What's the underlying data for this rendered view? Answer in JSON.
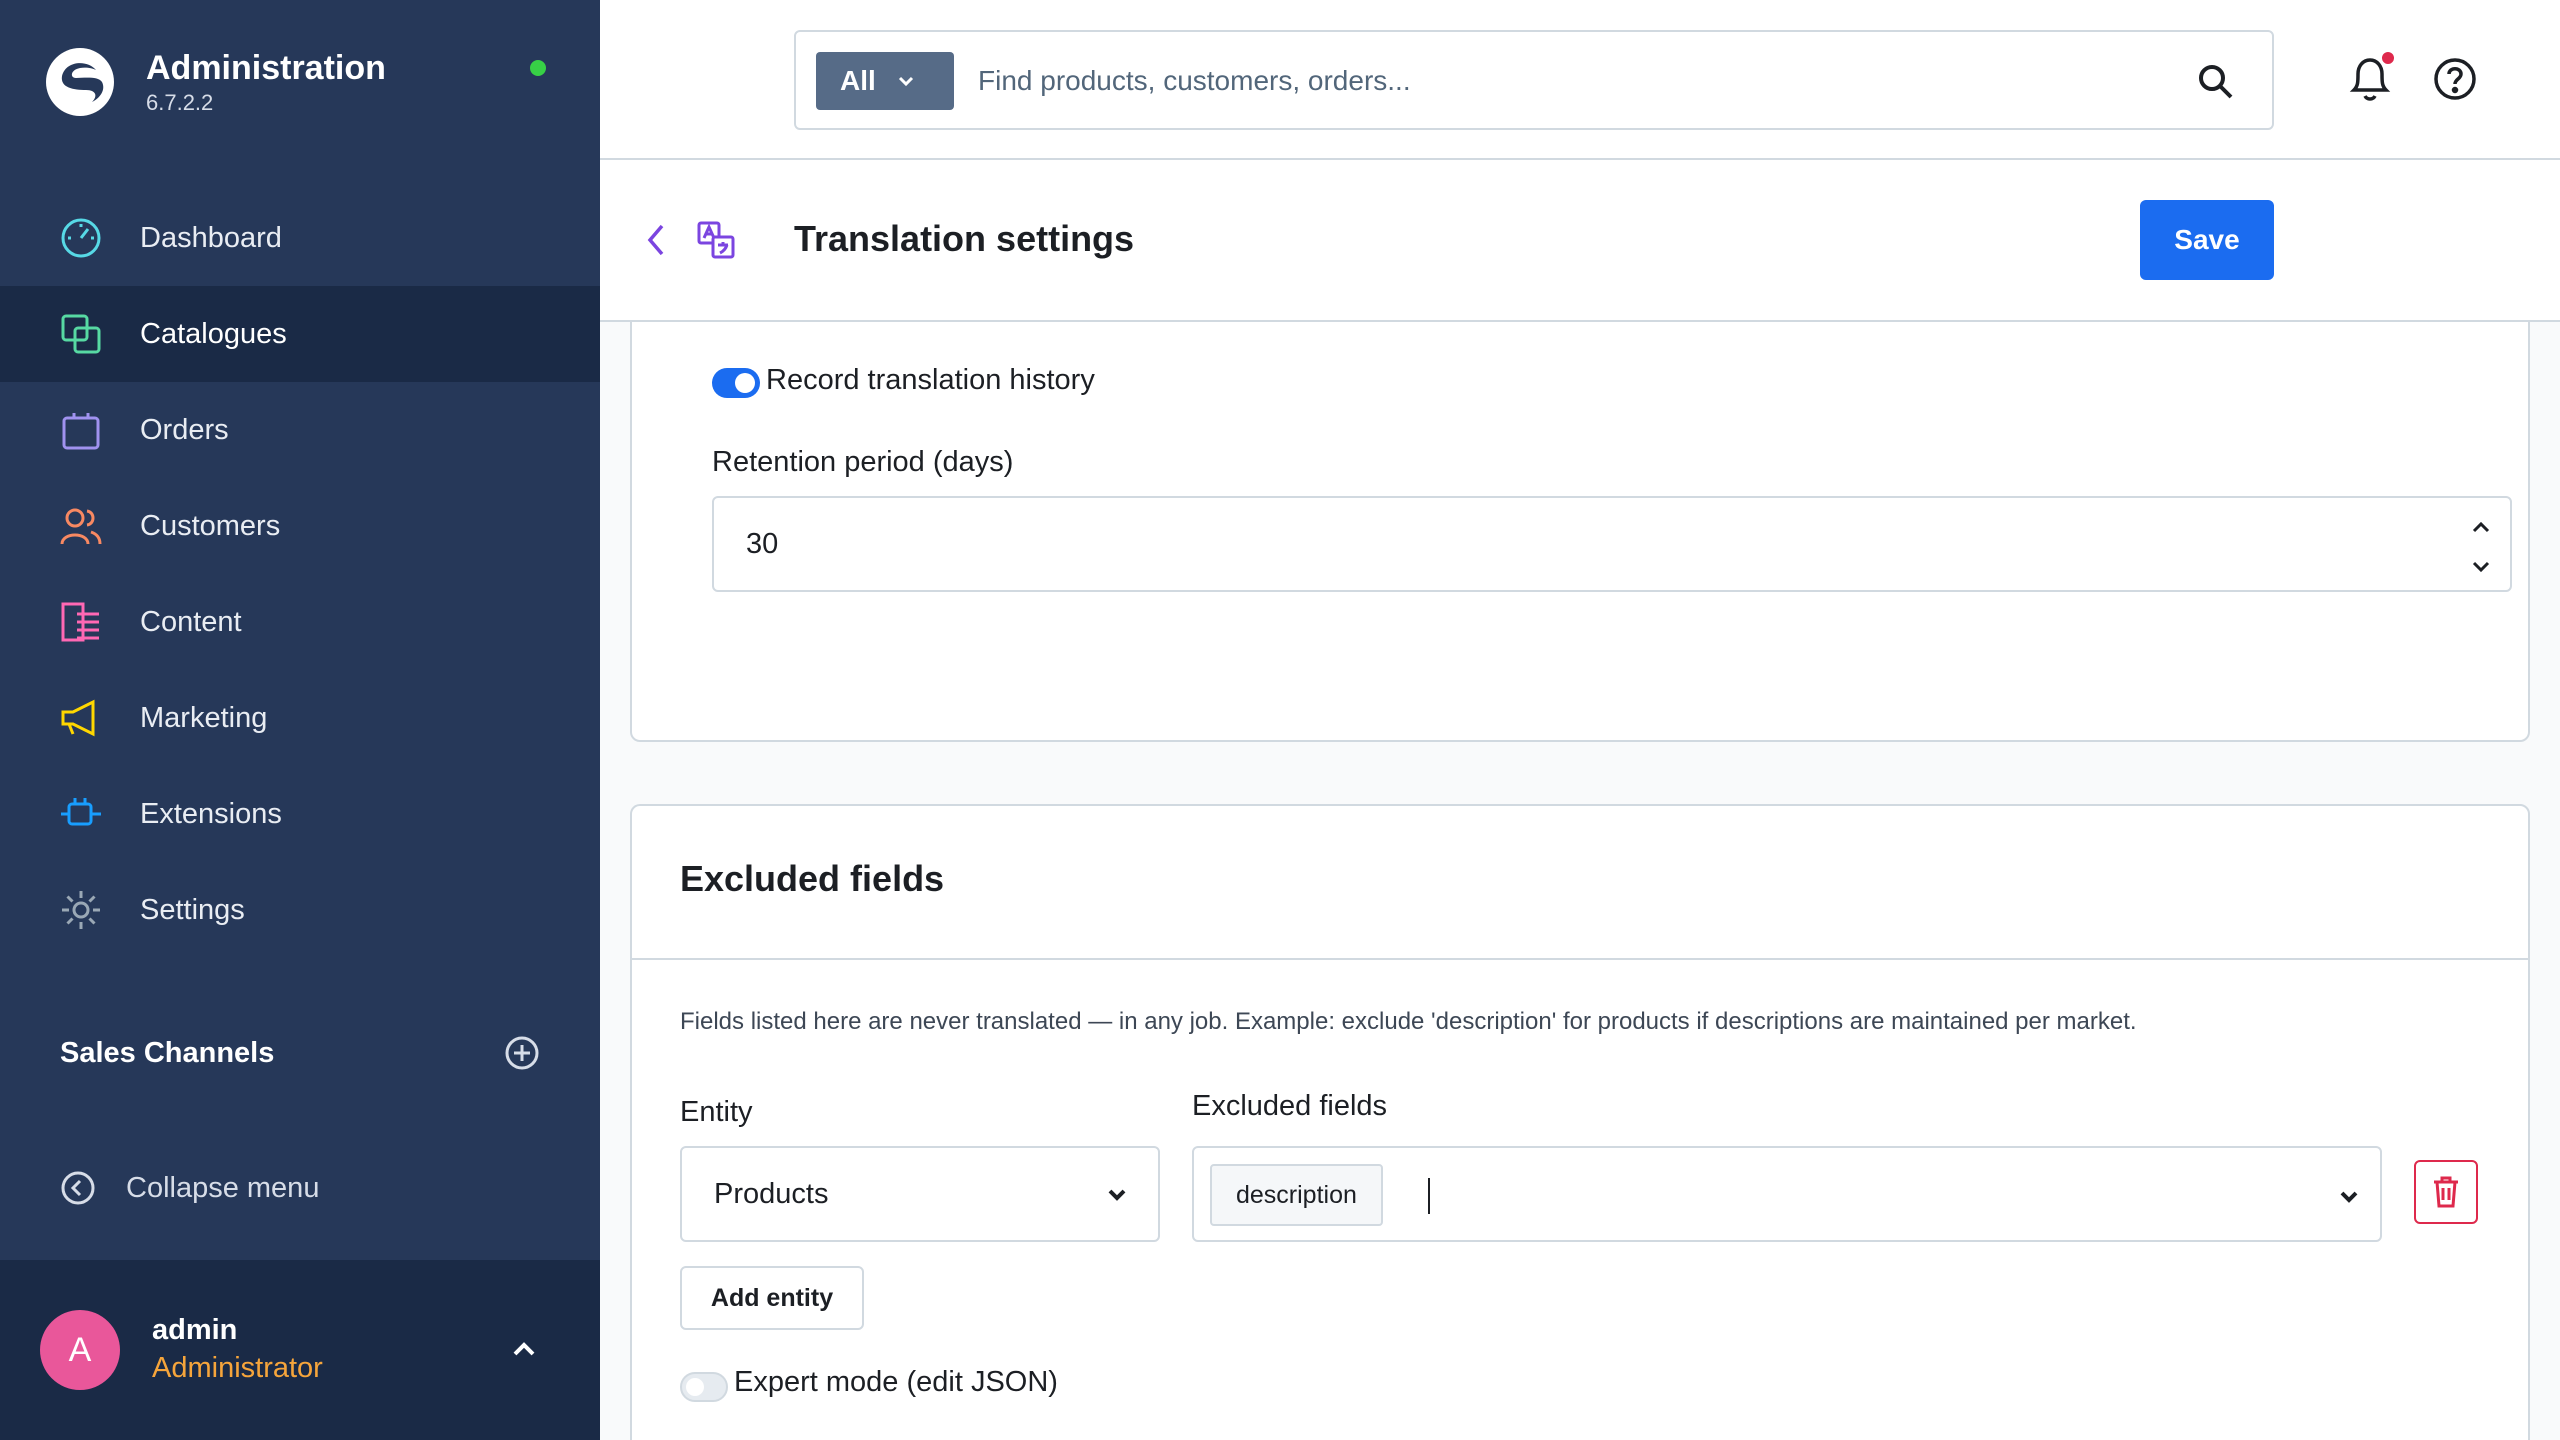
{
  "brand": {
    "title": "Administration",
    "version": "6.7.2.2"
  },
  "nav": [
    {
      "label": "Dashboard",
      "icon": "dashboard-icon",
      "color": "#57d9e6"
    },
    {
      "label": "Catalogues",
      "icon": "catalogues-icon",
      "color": "#57d9a3",
      "active": true
    },
    {
      "label": "Orders",
      "icon": "orders-icon",
      "color": "#a092f0"
    },
    {
      "label": "Customers",
      "icon": "customers-icon",
      "color": "#f88962"
    },
    {
      "label": "Content",
      "icon": "content-icon",
      "color": "#ff68b4"
    },
    {
      "label": "Marketing",
      "icon": "marketing-icon",
      "color": "#ffd700"
    },
    {
      "label": "Extensions",
      "icon": "extensions-icon",
      "color": "#189eff"
    },
    {
      "label": "Settings",
      "icon": "settings-icon",
      "color": "#9aa8b5"
    }
  ],
  "sales_channels": {
    "title": "Sales Channels"
  },
  "collapse_menu": "Collapse menu",
  "user": {
    "initial": "A",
    "name": "admin",
    "role": "Administrator"
  },
  "search": {
    "filter": "All",
    "placeholder": "Find products, customers, orders..."
  },
  "page": {
    "title": "Translation settings",
    "save_label": "Save"
  },
  "history": {
    "toggle_label": "Record translation history",
    "toggle_on": true,
    "retention_label": "Retention period (days)",
    "retention_value": "30"
  },
  "excluded": {
    "title": "Excluded fields",
    "help": "Fields listed here are never translated — in any job. Example: exclude 'description' for products if descriptions are maintained per market.",
    "entity_label": "Entity",
    "fields_label": "Excluded fields",
    "entity_value": "Products",
    "chips": [
      "description"
    ],
    "add_entity": "Add entity",
    "expert_label": "Expert mode (edit JSON)",
    "expert_on": false
  },
  "colors": {
    "sidebar": "#263859",
    "primary": "#1b6cf0",
    "danger": "#de294c",
    "status": "#37d046",
    "role": "#f6a53b",
    "avatar": "#e9579a"
  }
}
